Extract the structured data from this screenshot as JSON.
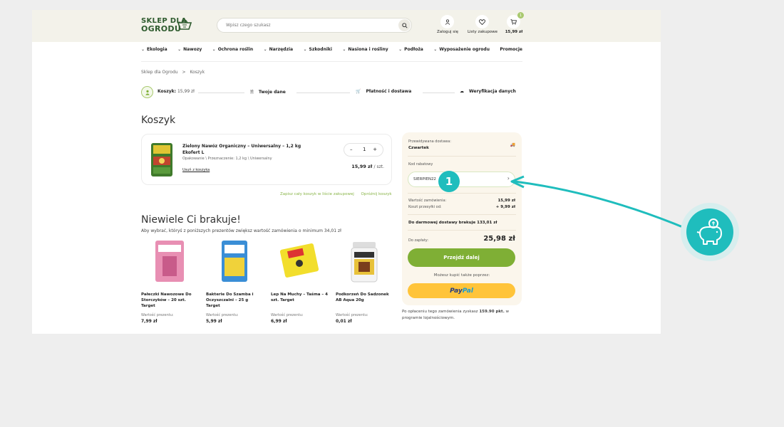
{
  "header": {
    "logo_line1": "SKLEP DLA",
    "logo_line2": "OGRODU",
    "search_placeholder": "Wpisz czego szukasz",
    "login_label": "Zaloguj się",
    "wishlist_label": "Listy zakupowe",
    "cart_total": "15,99 zł",
    "cart_count": "1"
  },
  "nav": [
    "Ekologia",
    "Nawozy",
    "Ochrona roślin",
    "Narzędzia",
    "Szkodniki",
    "Nasiona i rośliny",
    "Podłoża",
    "Wyposażenie ogrodu",
    "Promocje"
  ],
  "breadcrumb": {
    "home": "Sklep dla Ogrodu",
    "separator": ">",
    "current": "Koszyk"
  },
  "steps": {
    "cart_label": "Koszyk:",
    "cart_value": "15,99 zł",
    "data": "Twoje dane",
    "payment": "Płatność i dostawa",
    "verify": "Weryfikacja danych"
  },
  "cart": {
    "title": "Koszyk",
    "item": {
      "name": "Zielony Nawóz Organiczny – Uniwersalny – 1,2 kg Ekofert L",
      "meta": "Opakowanie \\ Przeznaczenie: 1,2 kg \\ Uniwersalny",
      "remove": "Usuń z koszyka",
      "qty_minus": "–",
      "qty": "1",
      "qty_plus": "+",
      "price": "15,99 zł",
      "unit": "/ szt."
    },
    "save_list": "Zapisz cały koszyk w liście zakupowej",
    "empty_cart": "Opróżnij koszyk"
  },
  "missing": {
    "title": "Niewiele Ci brakuje!",
    "subtitle": "Aby wybrać, któryś z poniższych prezentów zwiększ wartość zamówienia o minimum 34,01 zł",
    "value_label": "Wartość prezentu:",
    "gifts": [
      {
        "name": "Pałeczki Nawozowe Do Storczyków – 20 szt. Target",
        "price": "7,99 zł"
      },
      {
        "name": "Bakterie Do Szamba i Oczyszczalni – 25 g Target",
        "price": "5,99 zł"
      },
      {
        "name": "Lep Na Muchy – Taśma – 4 szt. Target",
        "price": "6,99 zł"
      },
      {
        "name": "Podkorzeń Do Sadzonek AB Aqua 20g",
        "price": "0,01 zł"
      }
    ]
  },
  "summary": {
    "delivery_label": "Przewidywana dostawa:",
    "delivery_day": "Czwartek",
    "code_label": "Kod rabatowy",
    "code_value": "SIERPIEN22",
    "code_arrow": "›",
    "order_value_label": "Wartość zamówienia:",
    "order_value": "15,99 zł",
    "shipping_label": "Koszt przesyłki od:",
    "shipping_value": "+ 9,99 zł",
    "free_shipping": "Do darmowej dostawy brakuje 133,01 zł",
    "to_pay_label": "Do zapłaty:",
    "to_pay": "25,98 zł",
    "proceed": "Przejdź dalej",
    "alt_buy": "Możesz kupić także poprzez:",
    "paypal_a": "Pay",
    "paypal_b": "Pal"
  },
  "loyalty": {
    "before": "Po opłaceniu tego zamówienia zyskasz ",
    "points": "159.90 pkt.",
    "after": " w programie lojalnościowym."
  },
  "annotation": {
    "marker": "1"
  },
  "colors": {
    "accent_green": "#7faf35",
    "teal": "#1fbdbd",
    "paypal_yellow": "#ffc43a",
    "summary_bg": "#fbf6ec"
  }
}
